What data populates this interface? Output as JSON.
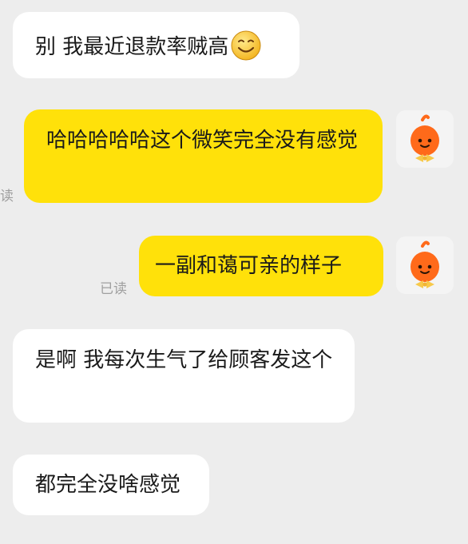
{
  "messages": [
    {
      "direction": "incoming",
      "text": "别 我最近退款率贼高",
      "emoji": "smiling-face"
    },
    {
      "direction": "outgoing",
      "text": "哈哈哈哈哈这个微笑完全没有感觉",
      "status": "读"
    },
    {
      "direction": "outgoing",
      "text": "一副和蔼可亲的样子",
      "status": "已读"
    },
    {
      "direction": "incoming",
      "text": "是啊 我每次生气了给顾客发这个"
    },
    {
      "direction": "incoming",
      "text": "都完全没啥感觉"
    }
  ],
  "colors": {
    "background": "#ededed",
    "incoming_bubble": "#ffffff",
    "outgoing_bubble": "#ffe10a",
    "avatar_mascot": "#ff6a1a"
  },
  "icons": {
    "avatar": "orange-mascot-avatar-icon",
    "emoji": "smiling-face-emoji-icon"
  }
}
